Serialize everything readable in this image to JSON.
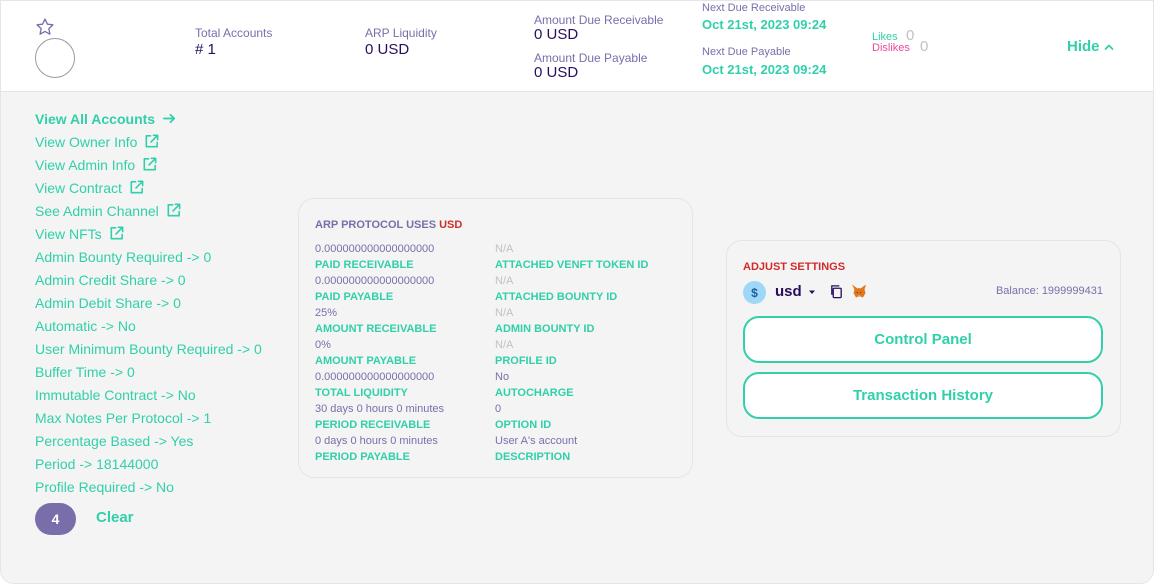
{
  "header": {
    "total_accounts_label": "Total Accounts",
    "total_accounts_value": "# 1",
    "arp_liquidity_label": "ARP Liquidity",
    "arp_liquidity_value": "0 USD",
    "amount_due_receivable_label": "Amount Due Receivable",
    "amount_due_receivable_value": "0 USD",
    "amount_due_payable_label": "Amount Due Payable",
    "amount_due_payable_value": "0 USD",
    "next_due_receivable_label": "Next Due Receivable",
    "next_due_receivable_value": "Oct 21st, 2023 09:24",
    "next_due_payable_label": "Next Due Payable",
    "next_due_payable_value": "Oct 21st, 2023 09:24",
    "likes_label": "Likes",
    "likes_count": "0",
    "dislikes_label": "Dislikes",
    "dislikes_count": "0",
    "hide_label": "Hide"
  },
  "links": [
    {
      "label": "View All Accounts",
      "icon": "arrow-right-icon"
    },
    {
      "label": "View Owner Info",
      "icon": "external-link-icon"
    },
    {
      "label": "View Admin Info",
      "icon": "external-link-icon"
    },
    {
      "label": "View Contract",
      "icon": "external-link-icon"
    },
    {
      "label": "See Admin Channel",
      "icon": "external-link-icon"
    },
    {
      "label": "View NFTs",
      "icon": "external-link-icon"
    }
  ],
  "properties": [
    "Admin Bounty Required -> 0",
    "Admin Credit Share -> 0",
    "Admin Debit Share -> 0",
    "Automatic -> No",
    "User Minimum Bounty Required -> 0",
    "Buffer Time -> 0",
    "Immutable Contract -> No",
    "Max Notes Per Protocol -> 1",
    "Percentage Based -> Yes",
    "Period -> 18144000",
    "Profile Required -> No"
  ],
  "footer": {
    "badge_count": "4",
    "clear_label": "Clear"
  },
  "protocol": {
    "title_prefix": "ARP PROTOCOL USES",
    "title_currency": "USD",
    "left": [
      {
        "value": "0.000000000000000000",
        "label": "PAID RECEIVABLE"
      },
      {
        "value": "0.000000000000000000",
        "label": "PAID PAYABLE"
      },
      {
        "value": "25%",
        "label": "AMOUNT RECEIVABLE"
      },
      {
        "value": "0%",
        "label": "AMOUNT PAYABLE"
      },
      {
        "value": "0.000000000000000000",
        "label": "TOTAL LIQUIDITY"
      },
      {
        "value": "30 days 0 hours 0 minutes",
        "label": "PERIOD RECEIVABLE"
      },
      {
        "value": "0 days 0 hours 0 minutes",
        "label": "PERIOD PAYABLE"
      }
    ],
    "right": [
      {
        "value": "N/A",
        "label": "ATTACHED VENFT TOKEN ID",
        "na": true
      },
      {
        "value": "N/A",
        "label": "ATTACHED BOUNTY ID",
        "na": true
      },
      {
        "value": "N/A",
        "label": "ADMIN BOUNTY ID",
        "na": true
      },
      {
        "value": "N/A",
        "label": "PROFILE ID",
        "na": true
      },
      {
        "value": "No",
        "label": "AUTOCHARGE",
        "na": false
      },
      {
        "value": "0",
        "label": "OPTION ID",
        "na": false
      },
      {
        "value": "User A's account",
        "label": "DESCRIPTION",
        "na": false
      }
    ]
  },
  "settings": {
    "title": "ADJUST SETTINGS",
    "token_symbol": "$",
    "token_name": "usd",
    "balance": "Balance: 1999999431",
    "control_panel_label": "Control Panel",
    "transaction_history_label": "Transaction History"
  },
  "colors": {
    "accent": "#31d0aa",
    "text_primary": "#280d5f",
    "text_secondary": "#7a6eaa",
    "danger": "#d12b2b",
    "pink": "#ed4b9e",
    "badge": "#7a6eaa"
  }
}
